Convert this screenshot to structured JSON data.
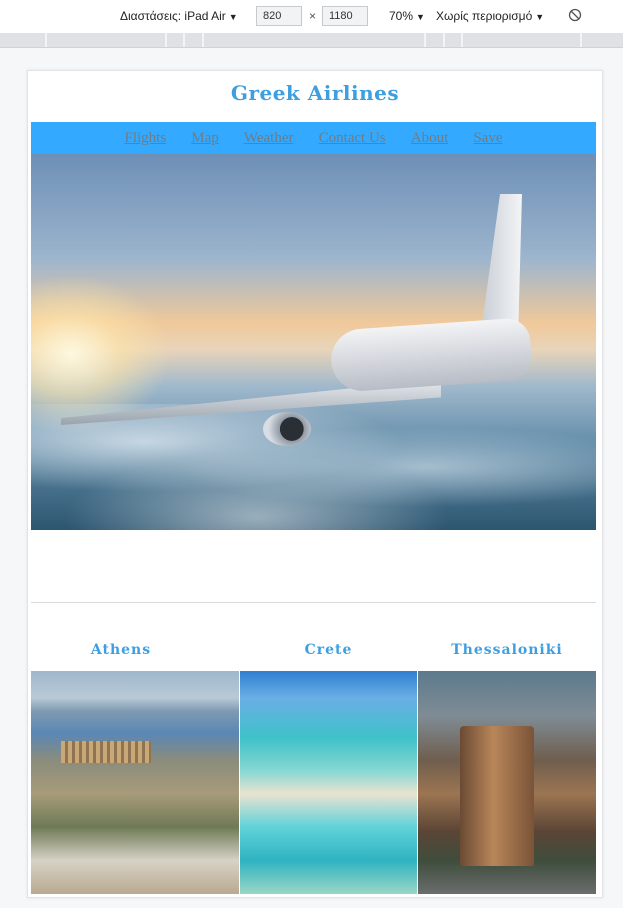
{
  "devtools": {
    "dimensions_label": "Διαστάσεις: iPad Air",
    "width_value": "820",
    "times_sign": "×",
    "height_value": "1180",
    "zoom_label": "70%",
    "throttle_label": "Χωρίς περιορισμό",
    "rotate_icon": "rotate-icon"
  },
  "site": {
    "title": "Greek Airlines",
    "nav": [
      "Flights",
      "Map",
      "Weather",
      "Contact Us",
      "About",
      "Save"
    ],
    "hero_image": "airplane-above-clouds",
    "cities": [
      {
        "name": "Athens",
        "image": "acropolis-photo"
      },
      {
        "name": "Crete",
        "image": "crete-lagoon-photo"
      },
      {
        "name": "Thessaloniki",
        "image": "white-tower-photo"
      }
    ]
  },
  "colors": {
    "accent": "#3d9fe0",
    "nav_bg": "#33aaff",
    "nav_link": "#6f7c86"
  }
}
